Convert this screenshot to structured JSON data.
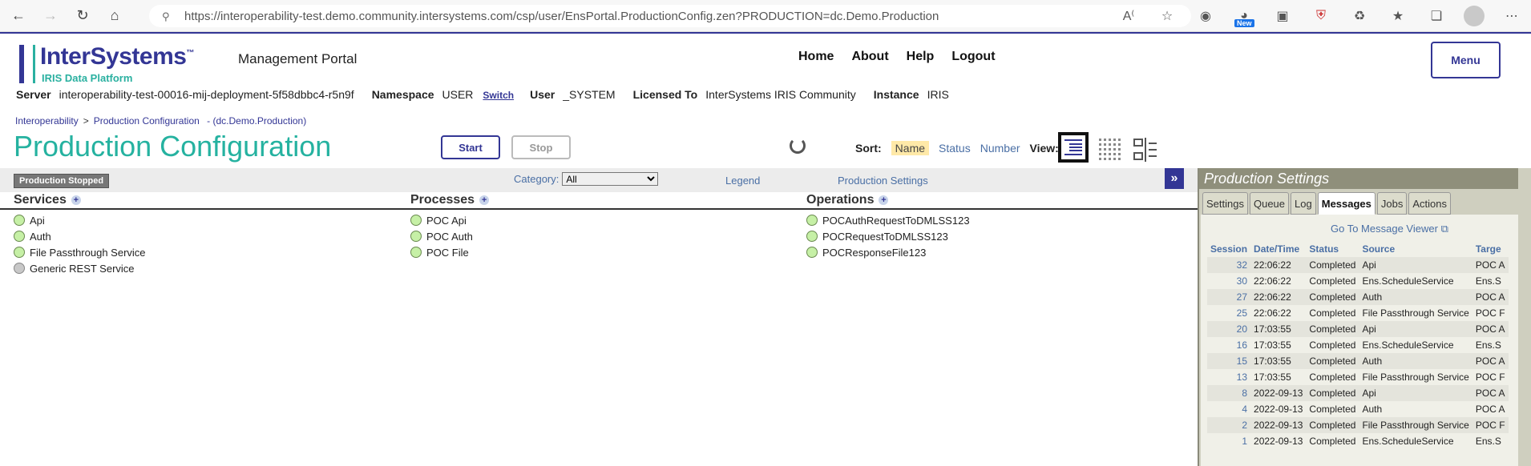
{
  "browser": {
    "url": "https://interoperability-test.demo.community.intersystems.com/csp/user/EnsPortal.ProductionConfig.zen?PRODUCTION=dc.Demo.Production",
    "new_badge": "New"
  },
  "header": {
    "brand": "InterSystems",
    "brand_sub": "IRIS Data Platform",
    "portal_title": "Management Portal",
    "links": [
      "Home",
      "About",
      "Help",
      "Logout"
    ],
    "menu_label": "Menu",
    "server_label": "Server",
    "server_value": "interoperability-test-00016-mij-deployment-5f58dbbc4-r5n9f",
    "namespace_label": "Namespace",
    "namespace_value": "USER",
    "switch_label": "Switch",
    "user_label": "User",
    "user_value": "_SYSTEM",
    "licensed_label": "Licensed To",
    "licensed_value": "InterSystems IRIS Community",
    "instance_label": "Instance",
    "instance_value": "IRIS"
  },
  "breadcrumb": {
    "root": "Interoperability",
    "sep": ">",
    "current": "Production Configuration",
    "production": "- (dc.Demo.Production)"
  },
  "page_title": "Production Configuration",
  "buttons": {
    "start": "Start",
    "stop": "Stop"
  },
  "sort": {
    "label": "Sort:",
    "options": [
      "Name",
      "Status",
      "Number"
    ],
    "view_label": "View:"
  },
  "toolbar": {
    "status": "Production Stopped",
    "category_label": "Category:",
    "category_value": "All",
    "legend": "Legend",
    "production_settings": "Production Settings",
    "collapse": "»"
  },
  "columns": {
    "services": {
      "title": "Services",
      "items": [
        {
          "name": "Api",
          "status": "on"
        },
        {
          "name": "Auth",
          "status": "on"
        },
        {
          "name": "File Passthrough Service",
          "status": "on"
        },
        {
          "name": "Generic REST Service",
          "status": "off"
        }
      ]
    },
    "processes": {
      "title": "Processes",
      "items": [
        {
          "name": "POC Api",
          "status": "on"
        },
        {
          "name": "POC Auth",
          "status": "on"
        },
        {
          "name": "POC File",
          "status": "on"
        }
      ]
    },
    "operations": {
      "title": "Operations",
      "items": [
        {
          "name": "POCAuthRequestToDMLSS123",
          "status": "on"
        },
        {
          "name": "POCRequestToDMLSS123",
          "status": "on"
        },
        {
          "name": "POCResponseFile123",
          "status": "on"
        }
      ]
    }
  },
  "right_panel": {
    "title": "Production Settings",
    "tabs": [
      "Settings",
      "Queue",
      "Log",
      "Messages",
      "Jobs",
      "Actions"
    ],
    "active_tab": "Messages",
    "goto": "Go To Message Viewer",
    "columns": [
      "Session",
      "Date/Time",
      "Status",
      "Source",
      "Targe"
    ],
    "rows": [
      {
        "session": "32",
        "time": "22:06:22",
        "status": "Completed",
        "source": "Api",
        "target": "POC A"
      },
      {
        "session": "30",
        "time": "22:06:22",
        "status": "Completed",
        "source": "Ens.ScheduleService",
        "target": "Ens.S"
      },
      {
        "session": "27",
        "time": "22:06:22",
        "status": "Completed",
        "source": "Auth",
        "target": "POC A"
      },
      {
        "session": "25",
        "time": "22:06:22",
        "status": "Completed",
        "source": "File Passthrough Service",
        "target": "POC F"
      },
      {
        "session": "20",
        "time": "17:03:55",
        "status": "Completed",
        "source": "Api",
        "target": "POC A"
      },
      {
        "session": "16",
        "time": "17:03:55",
        "status": "Completed",
        "source": "Ens.ScheduleService",
        "target": "Ens.S"
      },
      {
        "session": "15",
        "time": "17:03:55",
        "status": "Completed",
        "source": "Auth",
        "target": "POC A"
      },
      {
        "session": "13",
        "time": "17:03:55",
        "status": "Completed",
        "source": "File Passthrough Service",
        "target": "POC F"
      },
      {
        "session": "8",
        "time": "2022-09-13",
        "status": "Completed",
        "source": "Api",
        "target": "POC A"
      },
      {
        "session": "4",
        "time": "2022-09-13",
        "status": "Completed",
        "source": "Auth",
        "target": "POC A"
      },
      {
        "session": "2",
        "time": "2022-09-13",
        "status": "Completed",
        "source": "File Passthrough Service",
        "target": "POC F"
      },
      {
        "session": "1",
        "time": "2022-09-13",
        "status": "Completed",
        "source": "Ens.ScheduleService",
        "target": "Ens.S"
      }
    ]
  }
}
